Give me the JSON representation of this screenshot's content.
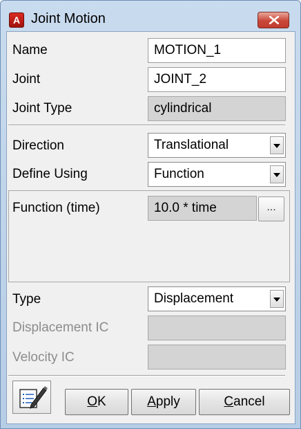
{
  "window": {
    "title": "Joint Motion",
    "app_icon_letter": "A"
  },
  "fields": {
    "name": {
      "label": "Name",
      "value": "MOTION_1"
    },
    "joint": {
      "label": "Joint",
      "value": "JOINT_2"
    },
    "joint_type": {
      "label": "Joint Type",
      "value": "cylindrical"
    },
    "direction": {
      "label": "Direction",
      "value": "Translational"
    },
    "define_using": {
      "label": "Define Using",
      "value": "Function"
    },
    "function": {
      "label": "Function (time)",
      "value": "10.0 * time",
      "button": "..."
    },
    "type": {
      "label": "Type",
      "value": "Displacement"
    },
    "displacement_ic": {
      "label": "Displacement IC",
      "value": ""
    },
    "velocity_ic": {
      "label": "Velocity IC",
      "value": ""
    }
  },
  "buttons": {
    "ok": {
      "mnemonic": "O",
      "rest": "K"
    },
    "apply": {
      "mnemonic": "A",
      "rest": "pply"
    },
    "cancel": {
      "mnemonic": "C",
      "rest": "ancel"
    }
  },
  "icons": {
    "close": "close-icon",
    "notes": "notes-edit-icon",
    "dropdown": "chevron-down-icon"
  },
  "colors": {
    "titlebar": "#b6cde6",
    "close_button": "#c9473a",
    "app_icon": "#c41e16",
    "readonly_field": "#d4d4d4",
    "disabled_label": "#8c8c8c"
  }
}
